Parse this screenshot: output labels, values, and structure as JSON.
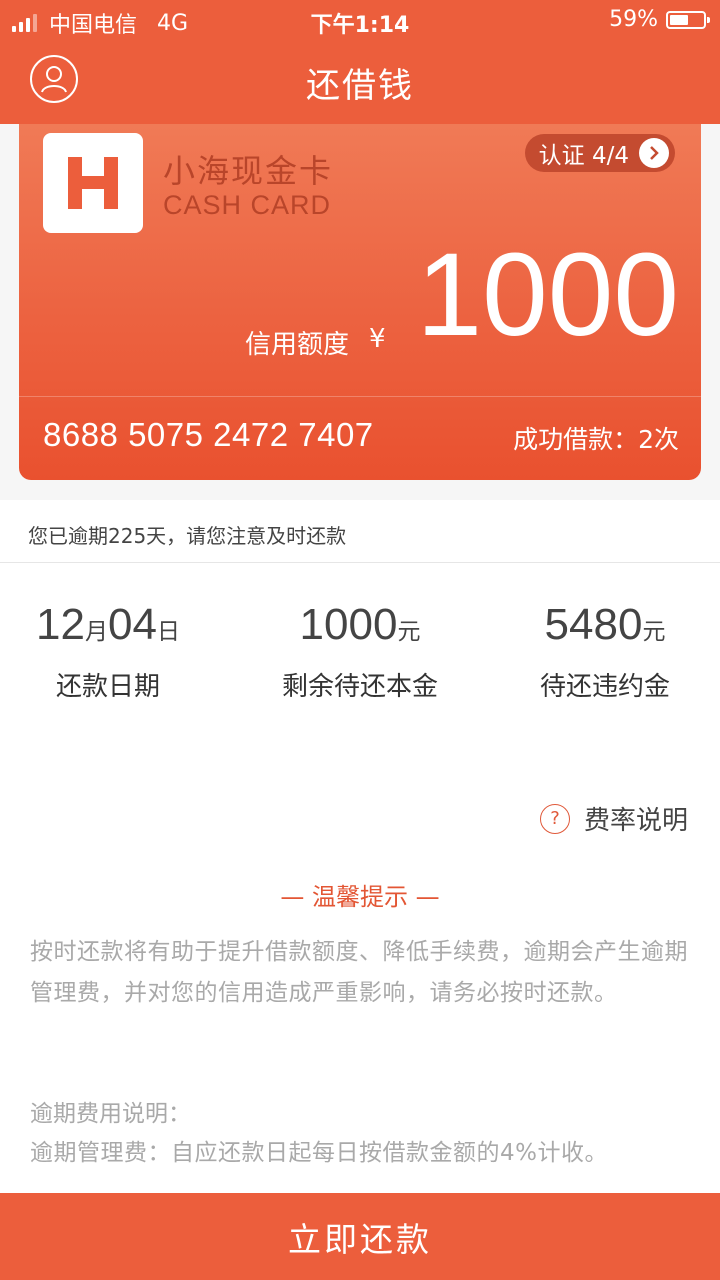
{
  "status_bar": {
    "carrier": "中国电信",
    "network": "4G",
    "time": "下午1:14",
    "battery_text": "59%",
    "battery_level": 0.59
  },
  "header": {
    "title": "还借钱",
    "avatar_icon": "user-icon"
  },
  "card": {
    "logo_letter": "H",
    "name": "小海现金卡",
    "subtitle": "CASH CARD",
    "cert_label": "认证 4/4",
    "credit_label": "信用额度",
    "currency": "¥",
    "credit_amount": "1000",
    "card_number": "8688 5075 2472 7407",
    "success_count": "成功借款：2次"
  },
  "notice": "您已逾期225天，请您注意及时还款",
  "stats": {
    "due_date": {
      "month": "12",
      "month_unit": "月",
      "day": "04",
      "day_unit": "日",
      "label": "还款日期"
    },
    "principal": {
      "value": "1000",
      "unit": "元",
      "label": "剩余待还本金"
    },
    "penalty": {
      "value": "5480",
      "unit": "元",
      "label": "待还违约金"
    }
  },
  "rate_link": "费率说明",
  "tips": {
    "title": "— 温馨提示 —",
    "body": "按时还款将有助于提升借款额度、降低手续费，逾期会产生逾期管理费，并对您的信用造成严重影响，请务必按时还款。",
    "fee_title": "逾期费用说明：",
    "fee_body": "逾期管理费：自应还款日起每日按借款金额的4%计收。"
  },
  "repay_button": "立即还款",
  "colors": {
    "brand": "#ec5e3c",
    "card_text_dark": "#b9452a",
    "tip_text": "#a9a9a9"
  }
}
